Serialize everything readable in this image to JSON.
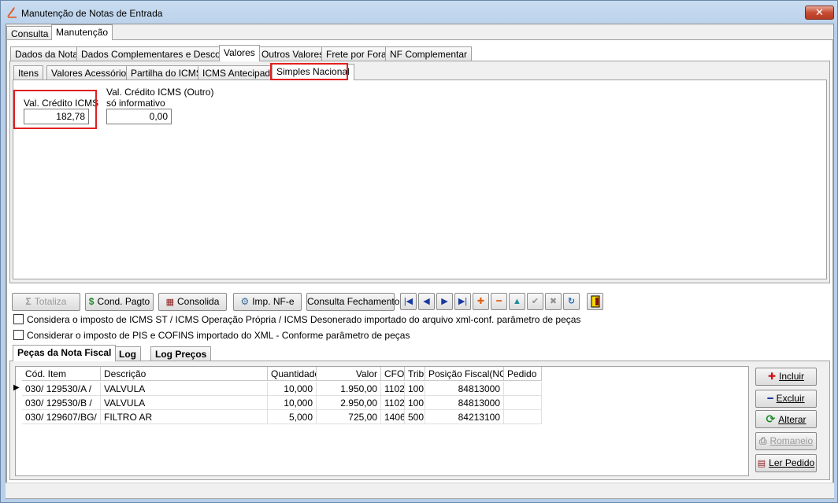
{
  "window": {
    "title": "Manutenção de Notas de Entrada",
    "close_label": "✕"
  },
  "main_tabs": [
    {
      "label": "Consulta"
    },
    {
      "label": "Manutenção"
    }
  ],
  "section_tabs": [
    {
      "label": "Dados da Nota"
    },
    {
      "label": "Dados Complementares e Desconto"
    },
    {
      "label": "Valores"
    },
    {
      "label": "Outros Valores"
    },
    {
      "label": "Frete por Fora"
    },
    {
      "label": "NF Complementar"
    }
  ],
  "valores_tabs": [
    {
      "label": "Itens"
    },
    {
      "label": "Valores Acessórios"
    },
    {
      "label": "Partilha do ICMS"
    },
    {
      "label": "ICMS Antecipado"
    },
    {
      "label": "Simples Nacional"
    }
  ],
  "simples": {
    "credito_label": "Val. Crédito ICMS",
    "credito_value": "182,78",
    "outro_label_line1": "Val. Crédito ICMS (Outro)",
    "outro_label_line2": "só informativo",
    "outro_value": "0,00"
  },
  "toolbar": {
    "totaliza": "Totaliza",
    "cond_pagto": "Cond. Pagto",
    "consolida": "Consolida",
    "imp_nfe": "Imp.  NF-e",
    "consulta_fechamento": "Consulta Fechamento"
  },
  "options": {
    "icms_st": "Considera o imposto de ICMS ST / ICMS Operação Própria / ICMS Desonerado importado do arquivo xml-conf. parâmetro de peças",
    "pis_cofins": "Considerar o imposto de PIS e COFINS importado do XML - Conforme parâmetro de peças"
  },
  "bottom_tabs": [
    {
      "label": "Peças da Nota Fiscal"
    },
    {
      "label": "Log"
    },
    {
      "label": "Log Preços"
    }
  ],
  "grid": {
    "columns": [
      "Cód. Item",
      "Descrição",
      "Quantidade",
      "Valor",
      "CFO",
      "Trib.",
      "Posição Fiscal(NCM)",
      "Pedido"
    ],
    "rows": [
      {
        "cod": "030/  129530/A /",
        "desc": "VALVULA",
        "qtd": "10,000",
        "valor": "1.950,00",
        "cfo": "1102",
        "trib": "100",
        "ncm": "84813000",
        "pedido": ""
      },
      {
        "cod": "030/  129530/B /",
        "desc": "VALVULA",
        "qtd": "10,000",
        "valor": "2.950,00",
        "cfo": "1102",
        "trib": "100",
        "ncm": "84813000",
        "pedido": ""
      },
      {
        "cod": "030/  129607/BG/",
        "desc": "FILTRO AR",
        "qtd": "5,000",
        "valor": "725,00",
        "cfo": "1406",
        "trib": "500",
        "ncm": "84213100",
        "pedido": ""
      }
    ]
  },
  "side_buttons": {
    "incluir": "Incluir",
    "excluir": "Excluir",
    "alterar": "Alterar",
    "romaneio": "Romaneio",
    "ler_pedido": "Ler Pedido"
  },
  "colors": {
    "highlight": "#e02020",
    "accent_green": "#1a8a2a",
    "accent_red": "#cc1010",
    "accent_blue": "#1a3aa0"
  }
}
